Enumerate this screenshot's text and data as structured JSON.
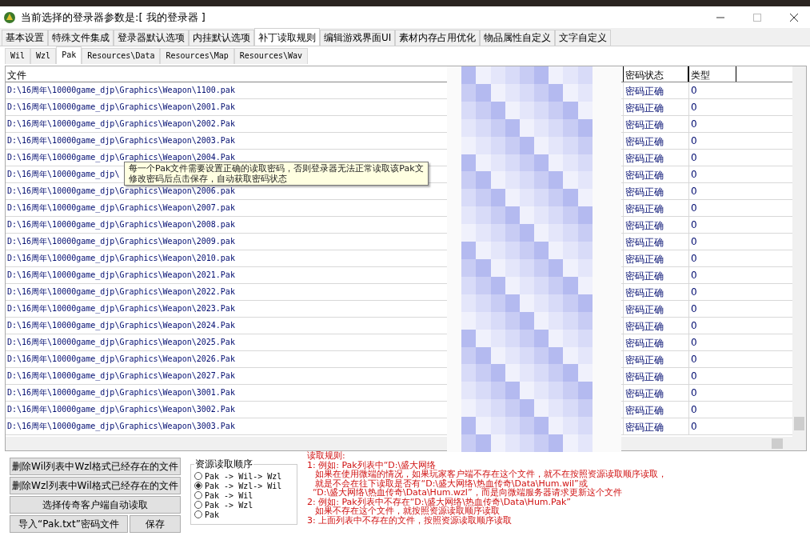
{
  "window": {
    "title": "当前选择的登录器参数是:[ 我的登录器 ]"
  },
  "tabs": [
    {
      "label": "基本设置",
      "selected": false
    },
    {
      "label": "特殊文件集成",
      "selected": false
    },
    {
      "label": "登录器默认选项",
      "selected": false
    },
    {
      "label": "内挂默认选项",
      "selected": false
    },
    {
      "label": "补丁读取规则",
      "selected": true
    },
    {
      "label": "编辑游戏界面UI",
      "selected": false
    },
    {
      "label": "素材内存占用优化",
      "selected": false
    },
    {
      "label": "物品属性自定义",
      "selected": false
    },
    {
      "label": "文字自定义",
      "selected": false
    }
  ],
  "subtabs": [
    {
      "label": "Wil",
      "selected": false
    },
    {
      "label": "Wzl",
      "selected": false
    },
    {
      "label": "Pak",
      "selected": true
    },
    {
      "label": "Resources\\Data",
      "selected": false
    },
    {
      "label": "Resources\\Map",
      "selected": false
    },
    {
      "label": "Resources\\Wav",
      "selected": false
    }
  ],
  "table": {
    "columns": [
      "文件",
      "密码状态",
      "类型"
    ],
    "rows": [
      {
        "file": "D:\\16周年\\10000game_djp\\Graphics\\Weapon\\1100.pak",
        "status": "密码正确",
        "type": "0"
      },
      {
        "file": "D:\\16周年\\10000game_djp\\Graphics\\Weapon\\2001.Pak",
        "status": "密码正确",
        "type": "0"
      },
      {
        "file": "D:\\16周年\\10000game_djp\\Graphics\\Weapon\\2002.Pak",
        "status": "密码正确",
        "type": "0"
      },
      {
        "file": "D:\\16周年\\10000game_djp\\Graphics\\Weapon\\2003.Pak",
        "status": "密码正确",
        "type": "0"
      },
      {
        "file": "D:\\16周年\\10000game_djp\\Graphics\\Weapon\\2004.Pak",
        "status": "密码正确",
        "type": "0"
      },
      {
        "file": "D:\\16周年\\10000game_djp\\",
        "status": "密码正确",
        "type": "0"
      },
      {
        "file": "D:\\16周年\\10000game_djp\\Graphics\\Weapon\\2006.pak",
        "status": "密码正确",
        "type": "0"
      },
      {
        "file": "D:\\16周年\\10000game_djp\\Graphics\\Weapon\\2007.pak",
        "status": "密码正确",
        "type": "0"
      },
      {
        "file": "D:\\16周年\\10000game_djp\\Graphics\\Weapon\\2008.pak",
        "status": "密码正确",
        "type": "0"
      },
      {
        "file": "D:\\16周年\\10000game_djp\\Graphics\\Weapon\\2009.pak",
        "status": "密码正确",
        "type": "0"
      },
      {
        "file": "D:\\16周年\\10000game_djp\\Graphics\\Weapon\\2010.pak",
        "status": "密码正确",
        "type": "0"
      },
      {
        "file": "D:\\16周年\\10000game_djp\\Graphics\\Weapon\\2021.Pak",
        "status": "密码正确",
        "type": "0"
      },
      {
        "file": "D:\\16周年\\10000game_djp\\Graphics\\Weapon\\2022.Pak",
        "status": "密码正确",
        "type": "0"
      },
      {
        "file": "D:\\16周年\\10000game_djp\\Graphics\\Weapon\\2023.Pak",
        "status": "密码正确",
        "type": "0"
      },
      {
        "file": "D:\\16周年\\10000game_djp\\Graphics\\Weapon\\2024.Pak",
        "status": "密码正确",
        "type": "0"
      },
      {
        "file": "D:\\16周年\\10000game_djp\\Graphics\\Weapon\\2025.Pak",
        "status": "密码正确",
        "type": "0"
      },
      {
        "file": "D:\\16周年\\10000game_djp\\Graphics\\Weapon\\2026.Pak",
        "status": "密码正确",
        "type": "0"
      },
      {
        "file": "D:\\16周年\\10000game_djp\\Graphics\\Weapon\\2027.Pak",
        "status": "密码正确",
        "type": "0"
      },
      {
        "file": "D:\\16周年\\10000game_djp\\Graphics\\Weapon\\3001.Pak",
        "status": "密码正确",
        "type": "0"
      },
      {
        "file": "D:\\16周年\\10000game_djp\\Graphics\\Weapon\\3002.Pak",
        "status": "密码正确",
        "type": "0"
      },
      {
        "file": "D:\\16周年\\10000game_djp\\Graphics\\Weapon\\3003.Pak",
        "status": "密码正确",
        "type": "0"
      }
    ]
  },
  "tooltip": [
    "每一个Pak文件需要设置正确的读取密码，否则登录器无法正常读取该Pak文",
    "修改密码后点击保存，自动获取密码状态"
  ],
  "buttons": [
    {
      "label": "删除Wil列表中Wzl格式已经存在的文件"
    },
    {
      "label": "删除Wzl列表中Wil格式已经存在的文件"
    },
    {
      "label": "选择传奇客户端自动读取"
    },
    {
      "label": "导入“Pak.txt”密码文件"
    },
    {
      "label": "保存"
    }
  ],
  "read_order": {
    "title": "资源读取顺序",
    "options": [
      {
        "label": "Pak -> Wil-> Wzl",
        "selected": false
      },
      {
        "label": "Pak -> Wzl-> Wil",
        "selected": true
      },
      {
        "label": "Pak -> Wil",
        "selected": false
      },
      {
        "label": "Pak -> Wzl",
        "selected": false
      },
      {
        "label": "Pak",
        "selected": false
      }
    ]
  },
  "rules": [
    "读取规则:",
    "1: 例如: Pak列表中“D:\\盛大网络",
    "   如果在使用微端的情况，如果玩家客户端不存在这个文件，就不在按照资源读取顺序读取，",
    "   就是不会在往下读取是否有“D:\\盛大网络\\热血传奇\\Data\\Hum.wil”或",
    "  “D:\\盛大网络\\热血传奇\\Data\\Hum.wzl”，而是向微端服务器请求更新这个文件",
    "2: 例如: Pak列表中不存在“D:\\盛大网络\\热血传奇\\Data\\Hum.Pak”",
    "   如果不存在这个文件，就按照资源读取顺序读取",
    "3: 上面列表中不存在的文件，按照资源读取顺序读取"
  ]
}
